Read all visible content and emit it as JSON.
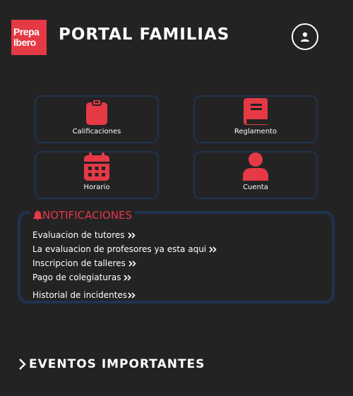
{
  "header": {
    "logo_line1": "Prepa",
    "logo_line2": "Ibero",
    "title": "Portal Familias"
  },
  "tiles": [
    {
      "label": "Calificaciones",
      "icon": "clipboard-icon"
    },
    {
      "label": "Reglamento",
      "icon": "book-icon"
    },
    {
      "label": "Horario",
      "icon": "calendar-icon"
    },
    {
      "label": "Cuenta",
      "icon": "user-icon"
    }
  ],
  "notifications": {
    "title": "NOTIFICACIONES",
    "items": [
      {
        "label": "Evaluacion de tutores"
      },
      {
        "label": "La evaluacion de profesores ya esta aqui"
      },
      {
        "label": "Inscripcion de talleres"
      },
      {
        "label": "Pago de colegiaturas"
      },
      {
        "label": "Historial de incidentes"
      }
    ]
  },
  "events": {
    "label": "Eventos importantes"
  },
  "colors": {
    "background": "#232323",
    "accent": "#e63946",
    "border": "#1f3350",
    "text": "#ffffff"
  }
}
